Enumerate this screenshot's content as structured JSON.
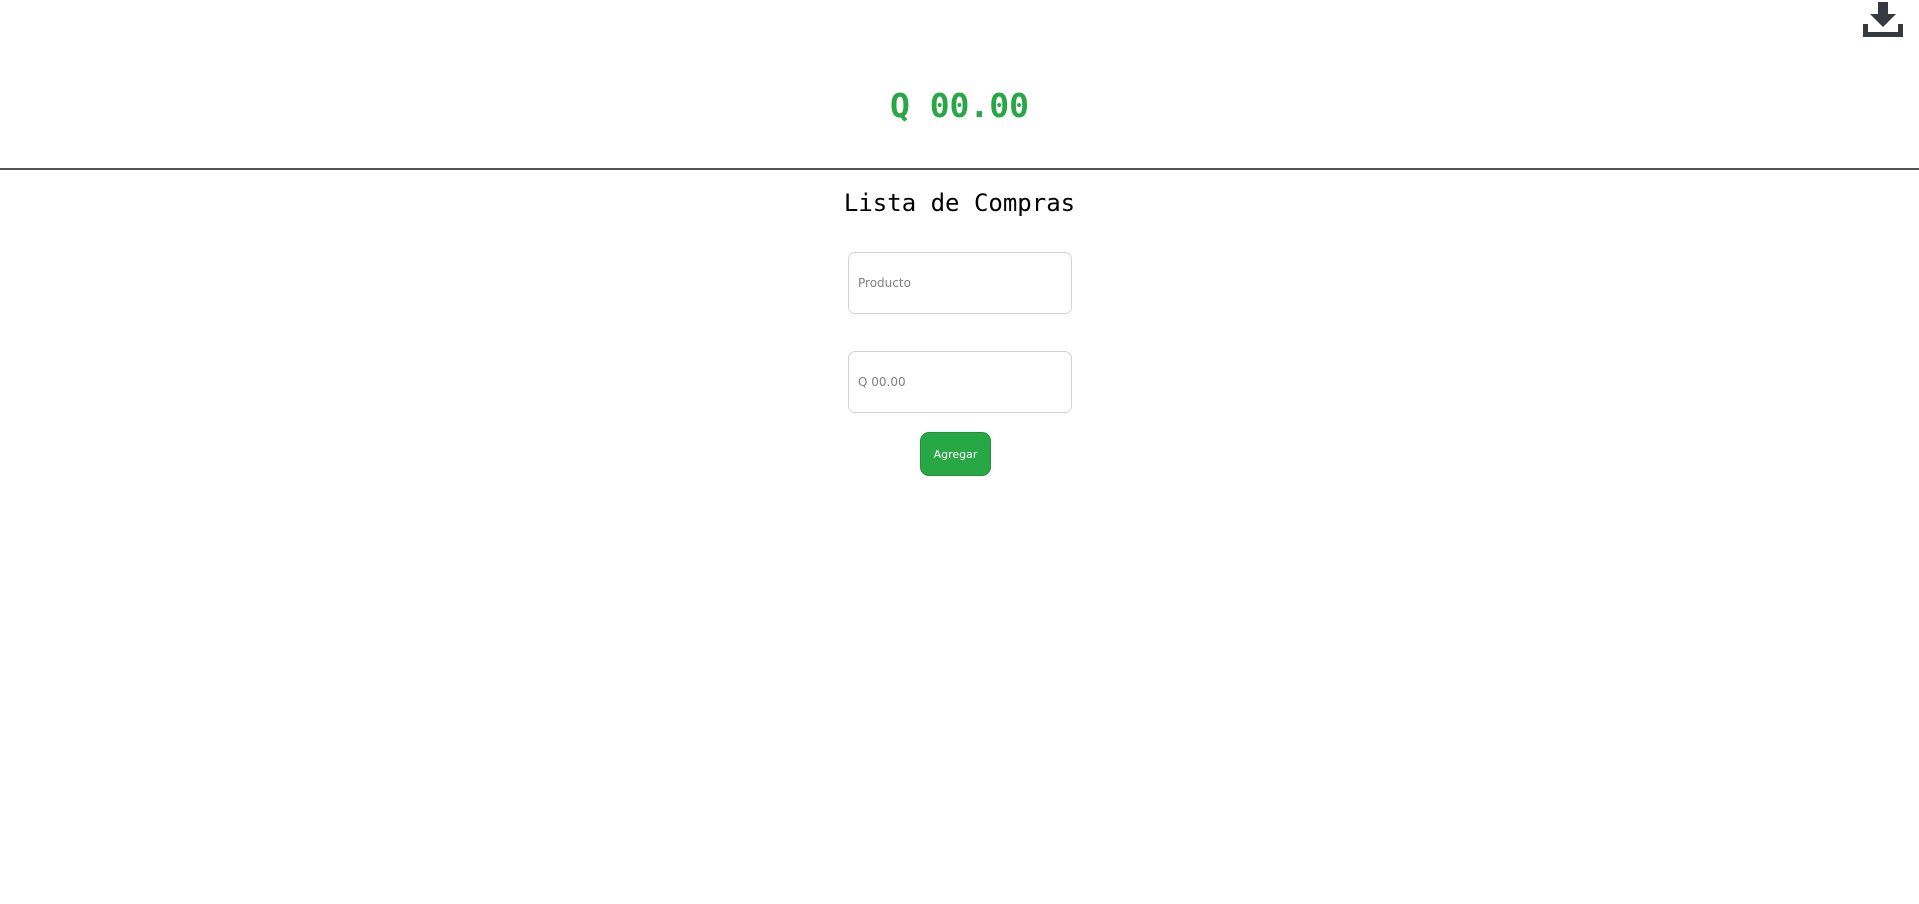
{
  "header": {
    "total": "Q 00.00",
    "download_icon": "download-icon"
  },
  "main": {
    "title": "Lista de Compras",
    "product_input": {
      "value": "",
      "placeholder": "Producto"
    },
    "price_input": {
      "value": "",
      "placeholder": "Q 00.00"
    },
    "add_button": {
      "label": "Agregar"
    }
  },
  "colors": {
    "accent": "#28a745",
    "icon": "#343a40",
    "divider": "#555555"
  }
}
